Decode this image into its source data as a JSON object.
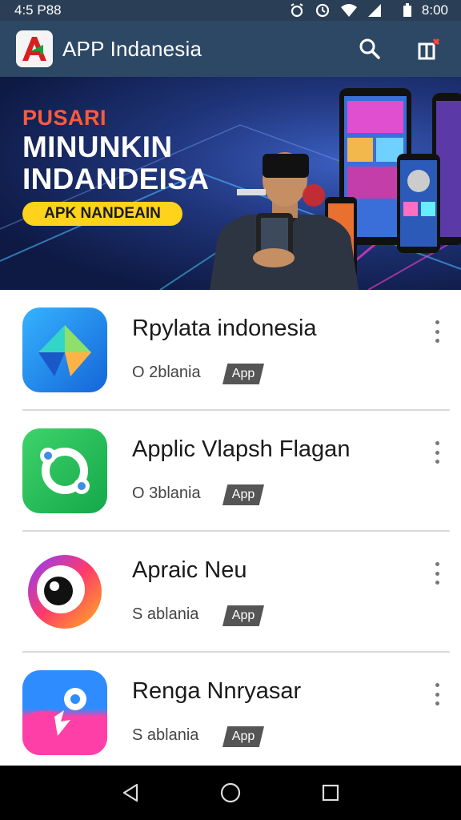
{
  "status_bar": {
    "left_text": "4:5 P88",
    "right_text": "8:00"
  },
  "app_bar": {
    "title": "APP Indanesia"
  },
  "banner": {
    "kicker": "PUSARI",
    "title_line1": "MINUNKIN",
    "title_line2": "INDANDEISA",
    "cta_label": "APK NANDEAIN"
  },
  "apps": [
    {
      "name": "Rpylata indonesia",
      "meta": "O 2blania",
      "tag": "App"
    },
    {
      "name": "Applic Vlapsh Flagan",
      "meta": "O 3blania",
      "tag": "App"
    },
    {
      "name": "Apraic Neu",
      "meta": "S ablania",
      "tag": "App"
    },
    {
      "name": "Renga Nnryasar",
      "meta": "S ablania",
      "tag": "App"
    }
  ],
  "colors": {
    "app_bar": "#2d4864",
    "status_bar": "#2a3e55",
    "banner_kicker": "#ff5a3c",
    "cta": "#ffd21c"
  },
  "icons": {
    "status": [
      "alarm-icon",
      "clock-icon",
      "wifi-icon",
      "signal-icon",
      "battery-icon"
    ],
    "app_bar": [
      "search-icon",
      "gift-icon"
    ],
    "nav": [
      "back-icon",
      "home-icon",
      "recents-icon"
    ]
  }
}
